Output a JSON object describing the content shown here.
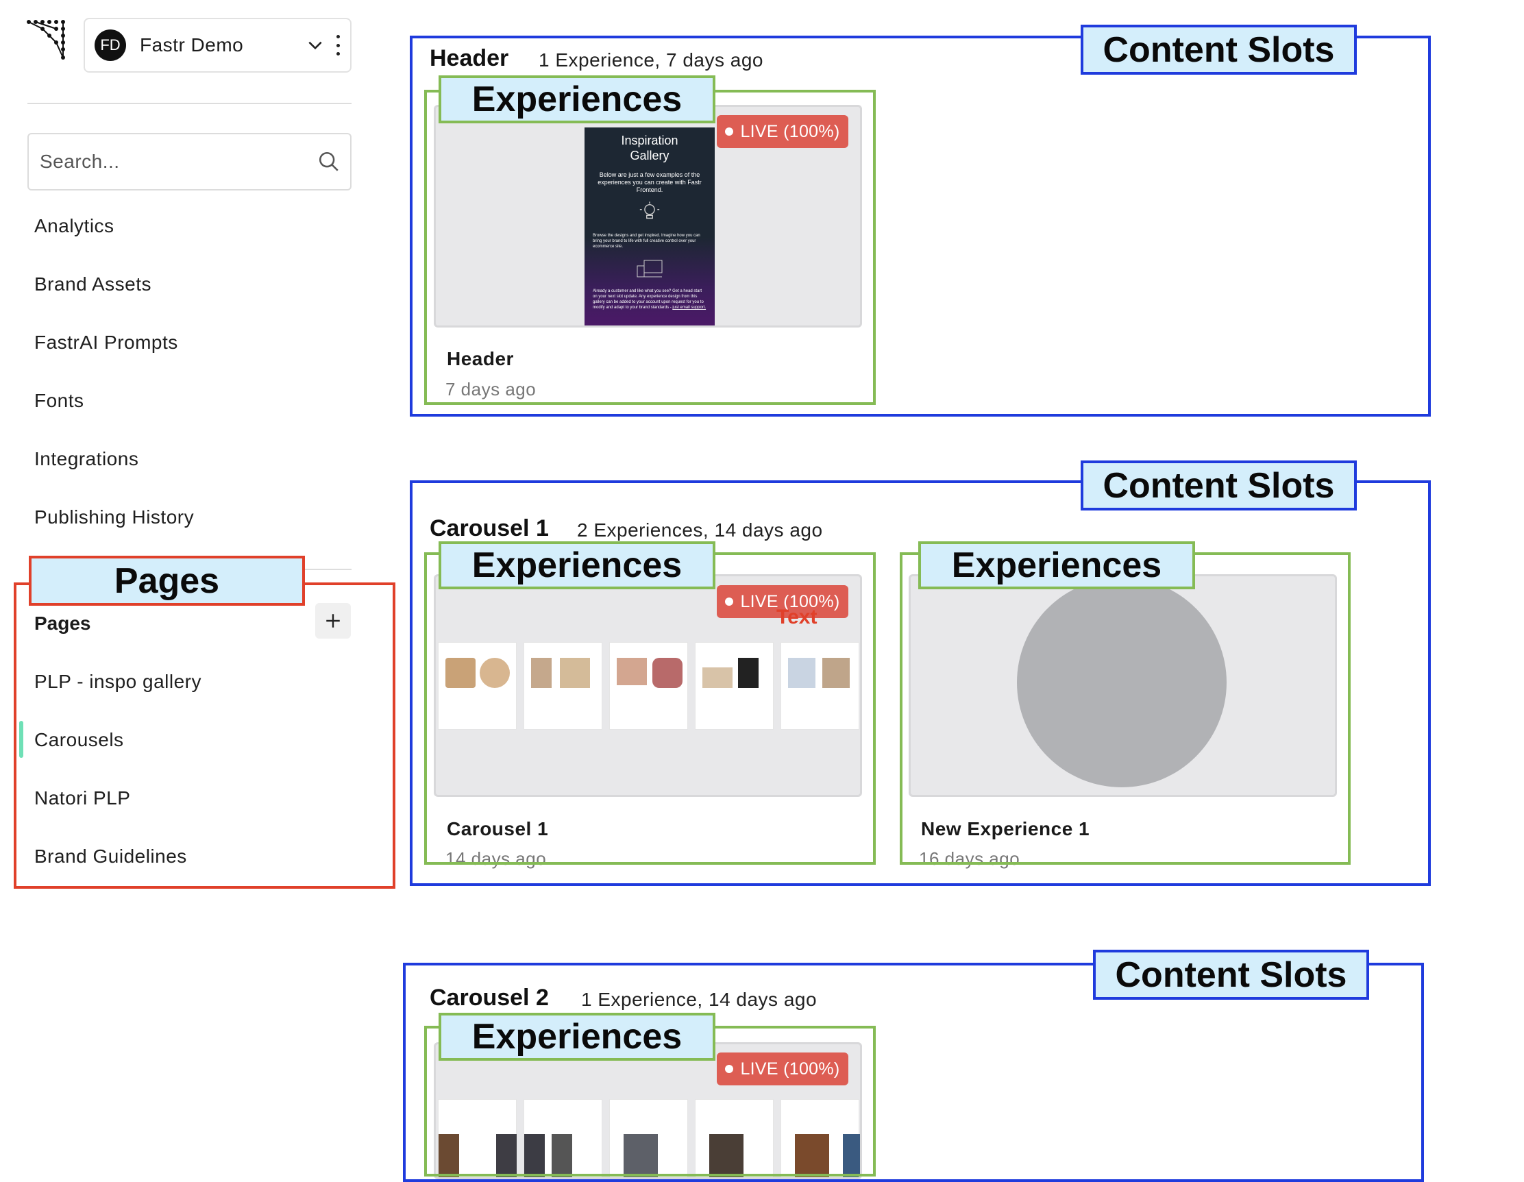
{
  "sidebar": {
    "org": {
      "initials": "FD",
      "name": "Fastr Demo"
    },
    "search": {
      "placeholder": "Search..."
    },
    "nav": [
      "Analytics",
      "Brand Assets",
      "FastrAI Prompts",
      "Fonts",
      "Integrations",
      "Publishing History"
    ],
    "pages": {
      "title": "Pages",
      "add": "+",
      "items": [
        "PLP - inspo gallery",
        "Carousels",
        "Natori PLP",
        "Brand Guidelines"
      ]
    }
  },
  "annotations": {
    "content_slots": "Content Slots",
    "experiences": "Experiences",
    "pages": "Pages",
    "overlay_text": "Text"
  },
  "slots": [
    {
      "name": "Header",
      "meta": "1 Experience, 7 days ago",
      "cards": [
        {
          "title": "Header",
          "sub": "7 days ago",
          "badge": "LIVE (100%)",
          "preview": {
            "heading": "Inspiration Gallery",
            "intro": "Below are just a few examples of the experiences you can create with Fastr Frontend.",
            "body": "Browse the designs and get inspired. Imagine how you can bring your brand to life with full creative control over your ecommerce site.",
            "footer": "Already a customer and like what you see? Get a head start on your next slot update. Any experience design from this gallery can be added to your account upon request for you to modify and adapt to your brand standards -",
            "footer_link": "just email support."
          }
        }
      ]
    },
    {
      "name": "Carousel 1",
      "meta": "2 Experiences, 14 days ago",
      "cards": [
        {
          "title": "Carousel 1",
          "sub": "14 days ago",
          "badge": "LIVE (100%)"
        },
        {
          "title": "New Experience 1",
          "sub": "16 days ago"
        }
      ]
    },
    {
      "name": "Carousel 2",
      "meta": "1 Experience, 14 days ago",
      "cards": [
        {
          "title": "",
          "sub": "",
          "badge": "LIVE (100%)"
        }
      ]
    }
  ],
  "colors": {
    "slot_frame": "#1f3bdd",
    "experience_frame": "#85bb55",
    "pages_frame": "#e0402a",
    "tag_fill": "#d4eefb",
    "live_badge": "#dd5d53",
    "active_indicator": "#6fe0b6"
  }
}
